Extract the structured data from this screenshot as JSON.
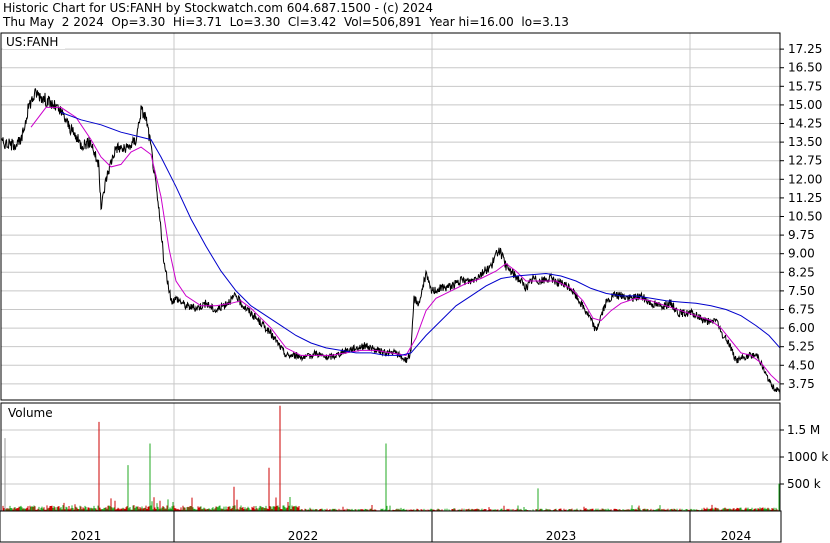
{
  "header": {
    "line1": "Historic Chart for US:FANH by Stockwatch.com 604.687.1500 - (c) 2024",
    "line2": "Thu May  2 2024  Op=3.30  Hi=3.71  Lo=3.30  Cl=3.42  Vol=506,891  Year hi=16.00  lo=3.13"
  },
  "colors": {
    "price": "#000000",
    "ma_short": "#cc00cc",
    "ma_long": "#0000cc",
    "volume_up": "#22aa22",
    "volume_down": "#cc0000",
    "grid": "#c8c8c8"
  },
  "chart_data": [
    {
      "type": "line",
      "panel_label": "US:FANH",
      "y_ticks": [
        "17.25",
        "16.50",
        "15.75",
        "15.00",
        "14.25",
        "13.50",
        "12.75",
        "12.00",
        "11.25",
        "10.50",
        "9.75",
        "9.00",
        "8.25",
        "7.50",
        "6.75",
        "6.00",
        "5.25",
        "4.50",
        "3.75"
      ],
      "ylim": [
        3.1,
        17.9
      ],
      "x_labels": [
        "2021",
        "2022",
        "2023",
        "2024"
      ],
      "grid": true,
      "series": [
        {
          "key": "close",
          "points": [
            [
              0,
              13.5
            ],
            [
              10,
              13.4
            ],
            [
              20,
              13.5
            ],
            [
              28,
              15.0
            ],
            [
              35,
              15.5
            ],
            [
              45,
              15.2
            ],
            [
              55,
              14.9
            ],
            [
              62,
              14.6
            ],
            [
              70,
              14.0
            ],
            [
              80,
              13.4
            ],
            [
              90,
              13.5
            ],
            [
              98,
              12.5
            ],
            [
              100,
              10.8
            ],
            [
              105,
              12.0
            ],
            [
              110,
              12.7
            ],
            [
              115,
              13.3
            ],
            [
              125,
              13.2
            ],
            [
              135,
              13.6
            ],
            [
              140,
              14.8
            ],
            [
              145,
              14.5
            ],
            [
              150,
              13.3
            ],
            [
              155,
              11.7
            ],
            [
              160,
              10.0
            ],
            [
              163,
              8.6
            ],
            [
              167,
              7.8
            ],
            [
              170,
              7.1
            ],
            [
              176,
              7.2
            ],
            [
              185,
              6.9
            ],
            [
              195,
              6.8
            ],
            [
              205,
              7.0
            ],
            [
              215,
              6.7
            ],
            [
              225,
              7.0
            ],
            [
              235,
              7.3
            ],
            [
              240,
              7.0
            ],
            [
              245,
              6.8
            ],
            [
              255,
              6.4
            ],
            [
              265,
              6.0
            ],
            [
              275,
              5.5
            ],
            [
              285,
              4.9
            ],
            [
              295,
              4.9
            ],
            [
              305,
              4.8
            ],
            [
              315,
              5.0
            ],
            [
              325,
              4.8
            ],
            [
              335,
              4.9
            ],
            [
              345,
              5.1
            ],
            [
              355,
              5.2
            ],
            [
              365,
              5.3
            ],
            [
              375,
              5.1
            ],
            [
              385,
              5.0
            ],
            [
              395,
              5.0
            ],
            [
              405,
              4.7
            ],
            [
              410,
              5.0
            ],
            [
              413,
              7.2
            ],
            [
              418,
              7.0
            ],
            [
              425,
              8.2
            ],
            [
              430,
              7.5
            ],
            [
              440,
              7.6
            ],
            [
              450,
              7.7
            ],
            [
              460,
              7.9
            ],
            [
              470,
              7.9
            ],
            [
              480,
              8.2
            ],
            [
              490,
              8.5
            ],
            [
              498,
              9.2
            ],
            [
              505,
              8.5
            ],
            [
              512,
              8.2
            ],
            [
              520,
              7.9
            ],
            [
              525,
              7.6
            ],
            [
              532,
              8.0
            ],
            [
              540,
              7.9
            ],
            [
              550,
              8.0
            ],
            [
              560,
              7.8
            ],
            [
              570,
              7.6
            ],
            [
              580,
              7.0
            ],
            [
              588,
              6.5
            ],
            [
              595,
              5.9
            ],
            [
              600,
              6.5
            ],
            [
              605,
              7.0
            ],
            [
              612,
              7.3
            ],
            [
              620,
              7.3
            ],
            [
              630,
              7.2
            ],
            [
              640,
              7.3
            ],
            [
              650,
              7.0
            ],
            [
              660,
              6.9
            ],
            [
              670,
              7.0
            ],
            [
              678,
              6.6
            ],
            [
              683,
              6.6
            ],
            [
              690,
              6.6
            ],
            [
              700,
              6.4
            ],
            [
              710,
              6.2
            ],
            [
              715,
              6.4
            ],
            [
              720,
              5.8
            ],
            [
              728,
              5.4
            ],
            [
              735,
              4.7
            ],
            [
              742,
              4.8
            ],
            [
              750,
              4.9
            ],
            [
              757,
              4.9
            ],
            [
              763,
              4.3
            ],
            [
              770,
              3.7
            ],
            [
              776,
              3.5
            ],
            [
              779,
              3.42
            ]
          ]
        },
        {
          "key": "ma_short",
          "points": [
            [
              30,
              14.1
            ],
            [
              45,
              14.9
            ],
            [
              60,
              14.9
            ],
            [
              75,
              14.5
            ],
            [
              90,
              13.6
            ],
            [
              100,
              12.9
            ],
            [
              110,
              12.5
            ],
            [
              120,
              12.6
            ],
            [
              130,
              13.1
            ],
            [
              140,
              13.3
            ],
            [
              150,
              13.0
            ],
            [
              160,
              11.3
            ],
            [
              168,
              9.2
            ],
            [
              175,
              7.9
            ],
            [
              185,
              7.3
            ],
            [
              200,
              6.9
            ],
            [
              215,
              6.9
            ],
            [
              230,
              7.0
            ],
            [
              240,
              7.1
            ],
            [
              250,
              6.8
            ],
            [
              260,
              6.4
            ],
            [
              270,
              6.0
            ],
            [
              285,
              5.2
            ],
            [
              300,
              4.9
            ],
            [
              315,
              4.9
            ],
            [
              330,
              4.9
            ],
            [
              345,
              5.0
            ],
            [
              360,
              5.1
            ],
            [
              375,
              5.1
            ],
            [
              390,
              5.0
            ],
            [
              405,
              4.9
            ],
            [
              415,
              5.6
            ],
            [
              425,
              6.7
            ],
            [
              435,
              7.2
            ],
            [
              450,
              7.5
            ],
            [
              465,
              7.8
            ],
            [
              480,
              8.0
            ],
            [
              495,
              8.3
            ],
            [
              505,
              8.6
            ],
            [
              515,
              8.3
            ],
            [
              525,
              7.9
            ],
            [
              540,
              7.9
            ],
            [
              555,
              7.9
            ],
            [
              570,
              7.6
            ],
            [
              582,
              7.1
            ],
            [
              592,
              6.4
            ],
            [
              600,
              6.3
            ],
            [
              610,
              6.7
            ],
            [
              620,
              7.0
            ],
            [
              635,
              7.2
            ],
            [
              650,
              7.1
            ],
            [
              665,
              6.9
            ],
            [
              680,
              6.7
            ],
            [
              695,
              6.5
            ],
            [
              710,
              6.3
            ],
            [
              720,
              6.0
            ],
            [
              730,
              5.5
            ],
            [
              740,
              5.0
            ],
            [
              750,
              4.9
            ],
            [
              760,
              4.6
            ],
            [
              770,
              4.1
            ],
            [
              778,
              3.8
            ]
          ]
        },
        {
          "key": "ma_long",
          "points": [
            [
              60,
              14.7
            ],
            [
              80,
              14.4
            ],
            [
              100,
              14.2
            ],
            [
              120,
              13.9
            ],
            [
              140,
              13.7
            ],
            [
              150,
              13.6
            ],
            [
              160,
              12.9
            ],
            [
              175,
              11.7
            ],
            [
              190,
              10.4
            ],
            [
              205,
              9.3
            ],
            [
              220,
              8.3
            ],
            [
              235,
              7.5
            ],
            [
              250,
              6.9
            ],
            [
              265,
              6.5
            ],
            [
              280,
              6.1
            ],
            [
              295,
              5.7
            ],
            [
              310,
              5.4
            ],
            [
              325,
              5.2
            ],
            [
              340,
              5.1
            ],
            [
              355,
              5.0
            ],
            [
              370,
              5.0
            ],
            [
              385,
              4.9
            ],
            [
              400,
              4.9
            ],
            [
              410,
              5.0
            ],
            [
              425,
              5.7
            ],
            [
              440,
              6.3
            ],
            [
              455,
              6.9
            ],
            [
              470,
              7.3
            ],
            [
              485,
              7.7
            ],
            [
              500,
              8.0
            ],
            [
              515,
              8.1
            ],
            [
              530,
              8.15
            ],
            [
              545,
              8.2
            ],
            [
              560,
              8.1
            ],
            [
              575,
              7.9
            ],
            [
              590,
              7.6
            ],
            [
              605,
              7.4
            ],
            [
              620,
              7.3
            ],
            [
              635,
              7.3
            ],
            [
              650,
              7.2
            ],
            [
              665,
              7.1
            ],
            [
              680,
              7.05
            ],
            [
              695,
              7.0
            ],
            [
              710,
              6.9
            ],
            [
              725,
              6.75
            ],
            [
              740,
              6.5
            ],
            [
              755,
              6.1
            ],
            [
              768,
              5.7
            ],
            [
              779,
              5.2
            ]
          ]
        }
      ]
    },
    {
      "type": "bar",
      "panel_label": "Volume",
      "y_ticks": [
        "1.5 M",
        "1000 k",
        "500 k"
      ],
      "ylim": [
        0,
        2000000
      ],
      "spikes": [
        {
          "x": 98,
          "value": 1650000,
          "dir": "down"
        },
        {
          "x": 127,
          "value": 850000,
          "dir": "up"
        },
        {
          "x": 149,
          "value": 1250000,
          "dir": "up"
        },
        {
          "x": 233,
          "value": 450000,
          "dir": "down"
        },
        {
          "x": 268,
          "value": 800000,
          "dir": "down"
        },
        {
          "x": 279,
          "value": 1950000,
          "dir": "down"
        },
        {
          "x": 385,
          "value": 1250000,
          "dir": "up"
        },
        {
          "x": 537,
          "value": 420000,
          "dir": "up"
        },
        {
          "x": 778,
          "value": 506891,
          "dir": "up"
        }
      ]
    }
  ]
}
